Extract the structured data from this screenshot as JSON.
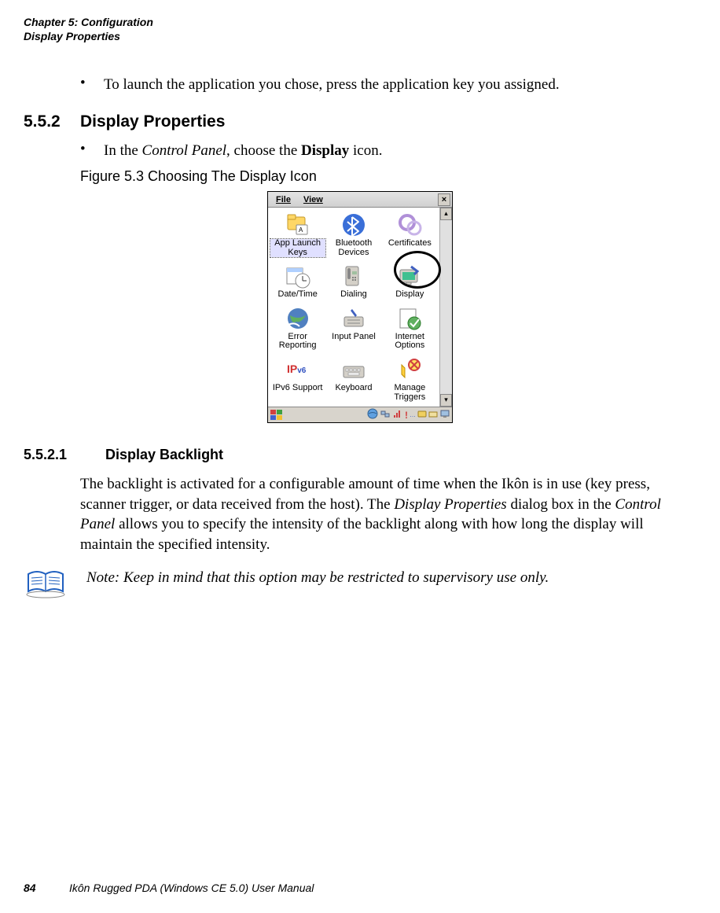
{
  "header": {
    "chapter": "Chapter 5:  Configuration",
    "section": "Display Properties"
  },
  "content": {
    "bullet1": "To launch the application you chose, press the application key you assigned.",
    "sec_num": "5.5.2",
    "sec_title": "Display Properties",
    "sec_bullet_pre": "In the ",
    "sec_bullet_italic": "Control Panel",
    "sec_bullet_mid": ", choose the ",
    "sec_bullet_bold": "Display",
    "sec_bullet_post": " icon.",
    "figure_caption": "Figure 5.3  Choosing The Display Icon",
    "screenshot": {
      "menu_file": "File",
      "menu_view": "View",
      "close": "×",
      "items": [
        {
          "label": "App Launch Keys",
          "name": "app-launch-keys"
        },
        {
          "label": "Bluetooth Devices",
          "name": "bluetooth-devices"
        },
        {
          "label": "Certificates",
          "name": "certificates"
        },
        {
          "label": "Date/Time",
          "name": "date-time"
        },
        {
          "label": "Dialing",
          "name": "dialing"
        },
        {
          "label": "Display",
          "name": "display"
        },
        {
          "label": "Error Reporting",
          "name": "error-reporting"
        },
        {
          "label": "Input Panel",
          "name": "input-panel"
        },
        {
          "label": "Internet Options",
          "name": "internet-options"
        },
        {
          "label": "IPv6 Support",
          "name": "ipv6-support"
        },
        {
          "label": "Keyboard",
          "name": "keyboard"
        },
        {
          "label": "Manage Triggers",
          "name": "manage-triggers"
        }
      ],
      "scroll_up": "▴",
      "scroll_down": "▾",
      "tray_exclaim": "!"
    },
    "subsec_num": "5.5.2.1",
    "subsec_title": "Display Backlight",
    "para_pre": "The backlight is activated for a configurable amount of time when the Ikôn is in use (key press, scanner trigger, or data received from the host). The ",
    "para_italic1": "Display Properties",
    "para_mid1": " dialog box in the ",
    "para_italic2": "Control Panel",
    "para_post": " allows you to specify the intensity of the backlight along with how long the display will maintain the specified intensity.",
    "note_label": "Note:",
    "note_text": " Keep in mind that this option may be restricted to supervisory use only."
  },
  "footer": {
    "page": "84",
    "title": "Ikôn Rugged PDA (Windows CE 5.0) User Manual"
  }
}
